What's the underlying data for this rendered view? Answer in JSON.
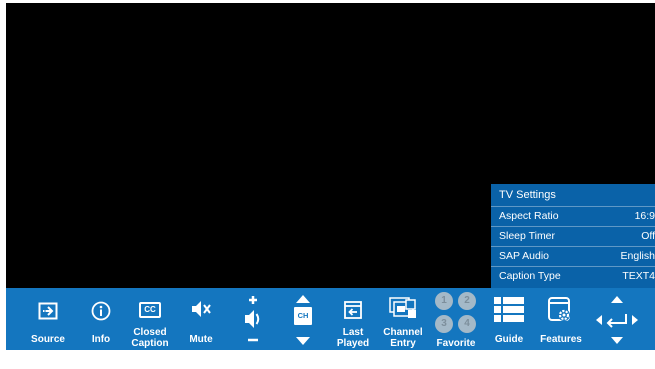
{
  "settings": {
    "title": "TV Settings",
    "rows": [
      {
        "label": "Aspect Ratio",
        "value": "16:9"
      },
      {
        "label": "Sleep Timer",
        "value": "Off"
      },
      {
        "label": "SAP Audio",
        "value": "English"
      },
      {
        "label": "Caption Type",
        "value": "TEXT4"
      }
    ]
  },
  "bar": {
    "source": "Source",
    "info": "Info",
    "cc_line1": "Closed",
    "cc_line2": "Caption",
    "cc_icon_text": "CC",
    "mute": "Mute",
    "ch_icon_text": "CH",
    "last_line1": "Last",
    "last_line2": "Played",
    "entry_line1": "Channel",
    "entry_line2": "Entry",
    "favorite": "Favorite",
    "fav_numbers": [
      "1",
      "2",
      "3",
      "4"
    ],
    "guide": "Guide",
    "features": "Features"
  },
  "colors": {
    "bar": "#1476bf",
    "panel": "#0a62a8",
    "screen": "#000000"
  }
}
